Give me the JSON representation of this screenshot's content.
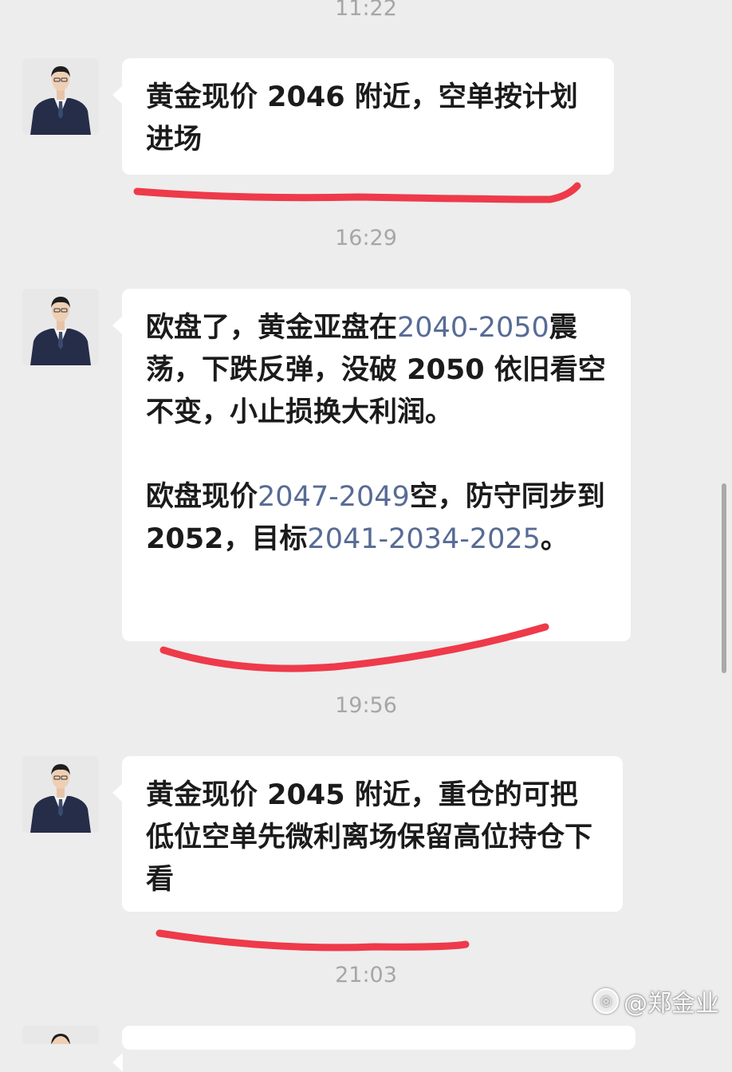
{
  "colors": {
    "background": "#ededed",
    "bubble": "#ffffff",
    "link": "#576b95",
    "timestamp": "#a6a6a6",
    "underline": "#ee3a4a"
  },
  "timestamps": [
    "11:22",
    "16:29",
    "19:56",
    "21:03"
  ],
  "messages": [
    {
      "avatar_icon": "person-in-suit-avatar",
      "paragraphs": [
        [
          {
            "text": "黄金现价 2046 附近，空单按计划进场",
            "link": false
          }
        ]
      ]
    },
    {
      "avatar_icon": "person-in-suit-avatar",
      "paragraphs": [
        [
          {
            "text": "欧盘了，黄金亚盘在",
            "link": false
          },
          {
            "text": "2040-2050",
            "link": true
          },
          {
            "text": "震荡，下跌反弹，没破 2050 依旧看空不变，小止损换大利润。",
            "link": false
          }
        ],
        [
          {
            "text": "欧盘现价",
            "link": false
          },
          {
            "text": "2047-2049",
            "link": true
          },
          {
            "text": "空，防守同步到 2052，目标",
            "link": false
          },
          {
            "text": "2041-2034-2025",
            "link": true
          },
          {
            "text": "。",
            "link": false
          }
        ]
      ]
    },
    {
      "avatar_icon": "person-in-suit-avatar",
      "paragraphs": [
        [
          {
            "text": "黄金现价 2045 附近，重仓的可把低位空单先微利离场保留高位持仓下看",
            "link": false
          }
        ]
      ]
    }
  ],
  "watermark": {
    "logo": "头条",
    "text": "@郑金业"
  }
}
